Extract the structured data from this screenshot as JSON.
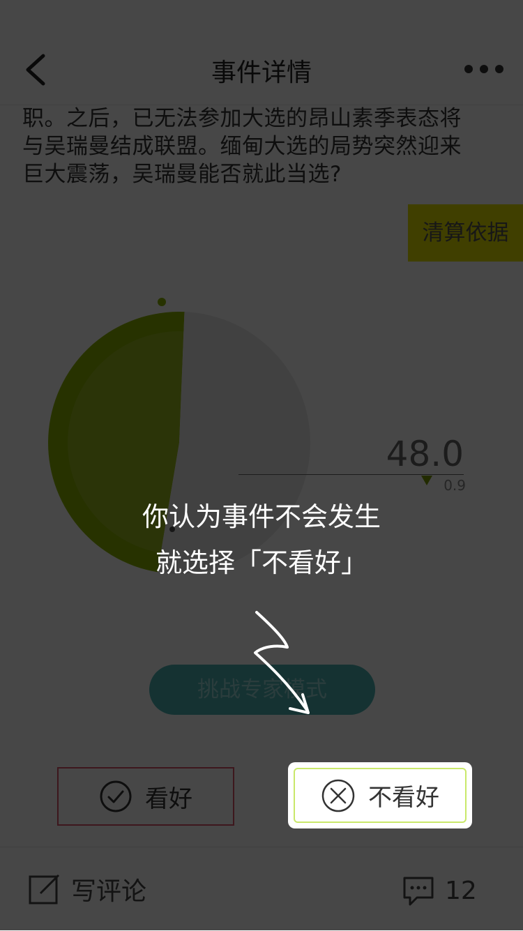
{
  "header": {
    "title": "事件详情"
  },
  "description": {
    "lines": [
      "职。之后，已无法参加大选的昂山素季表态将",
      "与吴瑞曼结成联盟。缅甸大选的局势突然迎来",
      "巨大震荡，吴瑞曼能否就此当选?"
    ]
  },
  "settle_button": "清算依据",
  "chart_data": {
    "type": "pie",
    "values": [
      48.0,
      52.0
    ],
    "change": "0.9",
    "change_direction": "down",
    "display_value": "48.0",
    "colors": {
      "primary": "#8bb300",
      "secondary": "#e8e8e8"
    }
  },
  "expert_button": "挑战专家模式",
  "vote": {
    "yes_label": "看好",
    "no_label": "不看好"
  },
  "bottom_bar": {
    "write_comment": "写评论",
    "comment_count": "12"
  },
  "guide": {
    "line1": "你认为事件不会发生",
    "line2": "就选择「不看好」"
  },
  "colors": {
    "accent_yellow": "#e6e200",
    "teal": "#4bb3b4",
    "yes_border": "#d9546a",
    "no_border": "#c9e86a"
  }
}
